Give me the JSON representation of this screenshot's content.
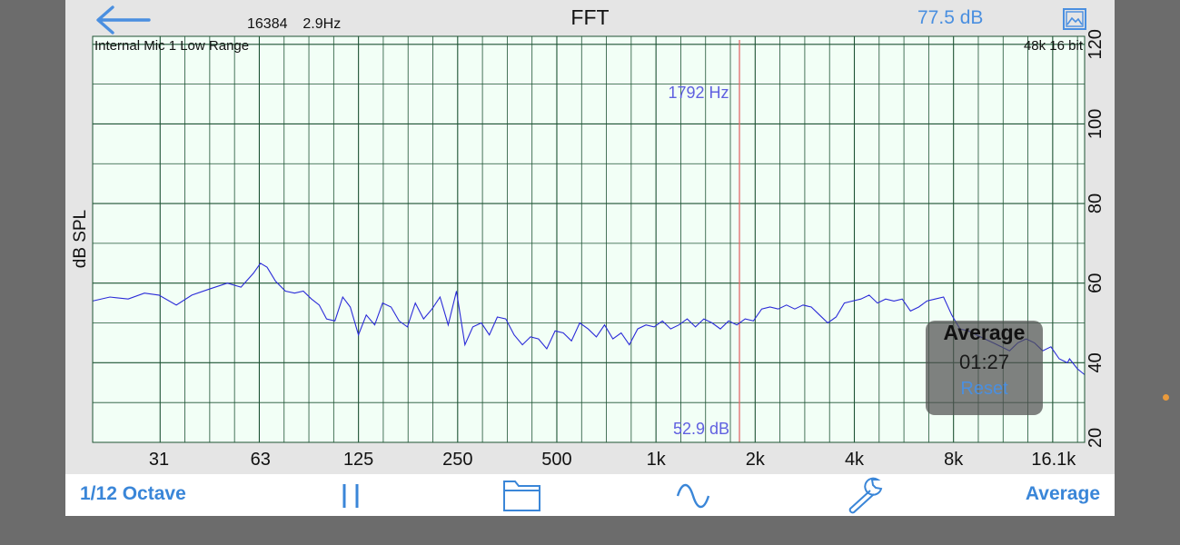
{
  "header": {
    "fft_size": "16384",
    "resolution": "2.9Hz",
    "title": "FFT",
    "level_readout": "77.5 dB",
    "back_icon": "back-arrow-icon",
    "image_icon": "image-icon"
  },
  "plot": {
    "input_label": "Internal Mic 1 Low Range",
    "format_label": "48k 16 bit",
    "y_axis_label": "dB SPL",
    "cursor_frequency": "1792 Hz",
    "cursor_level": "52.9 dB",
    "colors": {
      "background": "#f2fff6",
      "grid": "#1e5234",
      "trace": "#2a2ad8",
      "cursor": "#e26b6b"
    }
  },
  "chart_data": {
    "type": "line",
    "x_scale": "log",
    "xlim": [
      19.5,
      20000
    ],
    "ylim": [
      20,
      122
    ],
    "x_tick_labels": [
      {
        "label": "31",
        "value": 31
      },
      {
        "label": "63",
        "value": 63
      },
      {
        "label": "125",
        "value": 125
      },
      {
        "label": "250",
        "value": 250
      },
      {
        "label": "500",
        "value": 500
      },
      {
        "label": "1k",
        "value": 1000
      },
      {
        "label": "2k",
        "value": 2000
      },
      {
        "label": "4k",
        "value": 4000
      },
      {
        "label": "8k",
        "value": 8000
      },
      {
        "label": "16.1k",
        "value": 16100
      }
    ],
    "y_tick_labels": [
      {
        "label": "20",
        "value": 20
      },
      {
        "label": "40",
        "value": 40
      },
      {
        "label": "60",
        "value": 60
      },
      {
        "label": "80",
        "value": 80
      },
      {
        "label": "100",
        "value": 100
      },
      {
        "label": "120",
        "value": 120
      }
    ],
    "cursor_x": 1792,
    "series": [
      {
        "x": [
          19.5,
          22,
          25,
          28,
          31,
          35,
          39,
          44,
          50,
          55,
          60,
          63,
          66,
          70,
          75,
          80,
          85,
          90,
          95,
          100,
          106,
          112,
          118,
          125,
          132,
          140,
          148,
          157,
          166,
          176,
          186,
          197,
          209,
          221,
          234,
          248,
          263,
          278,
          295,
          312,
          330,
          350,
          371,
          393,
          416,
          440,
          466,
          494,
          523,
          554,
          587,
          622,
          659,
          698,
          740,
          784,
          830,
          880,
          932,
          987,
          1046,
          1108,
          1174,
          1244,
          1318,
          1397,
          1480,
          1568,
          1661,
          1760,
          1865,
          1976,
          2093,
          2217,
          2349,
          2489,
          2637,
          2794,
          2960,
          3136,
          3322,
          3520,
          3729,
          3951,
          4186,
          4435,
          4699,
          4978,
          5274,
          5588,
          5920,
          6272,
          6645,
          7040,
          7459,
          7902,
          8372,
          8870,
          9397,
          9956,
          10548,
          11175,
          11840,
          12544,
          13290,
          14080,
          14917,
          15804,
          16744,
          17740,
          18000,
          19000,
          20000
        ],
        "y": [
          55.5,
          56.5,
          56,
          57.5,
          57,
          54.5,
          57,
          58.5,
          60,
          59,
          62.5,
          65,
          64,
          60.5,
          58,
          57.5,
          58,
          56,
          54.5,
          51,
          50.5,
          56.5,
          54,
          47,
          52,
          49.5,
          55,
          54,
          50.5,
          49,
          55,
          51,
          53.5,
          56.5,
          49.5,
          58,
          44.5,
          49,
          50,
          47,
          51.5,
          51,
          47,
          44.5,
          46.5,
          46,
          43.5,
          48,
          47.5,
          45.5,
          50,
          48.5,
          46.5,
          49.5,
          46,
          47.5,
          44.5,
          48.5,
          49.5,
          49,
          50.5,
          48.5,
          49.5,
          51,
          49,
          51,
          50,
          48.5,
          50.5,
          49.5,
          51,
          50.5,
          53.5,
          54,
          53.5,
          54.5,
          53.5,
          54.5,
          54,
          52,
          50,
          51.5,
          55,
          55.5,
          56,
          57,
          55,
          56,
          55.5,
          56,
          53,
          54,
          55.5,
          56,
          56.5,
          52,
          48.5,
          48,
          47,
          46,
          45,
          44,
          43,
          45,
          46,
          45,
          43,
          44,
          41,
          40,
          41,
          38.5,
          37
        ]
      }
    ]
  },
  "average_panel": {
    "title": "Average",
    "elapsed": "01:27",
    "reset_label": "Reset"
  },
  "toolbar": {
    "resolution_label": "1/12 Octave",
    "pause_icon": "pause-icon",
    "folder_icon": "folder-icon",
    "waveform_icon": "sine-wave-icon",
    "settings_icon": "wrench-icon",
    "mode_label": "Average"
  }
}
